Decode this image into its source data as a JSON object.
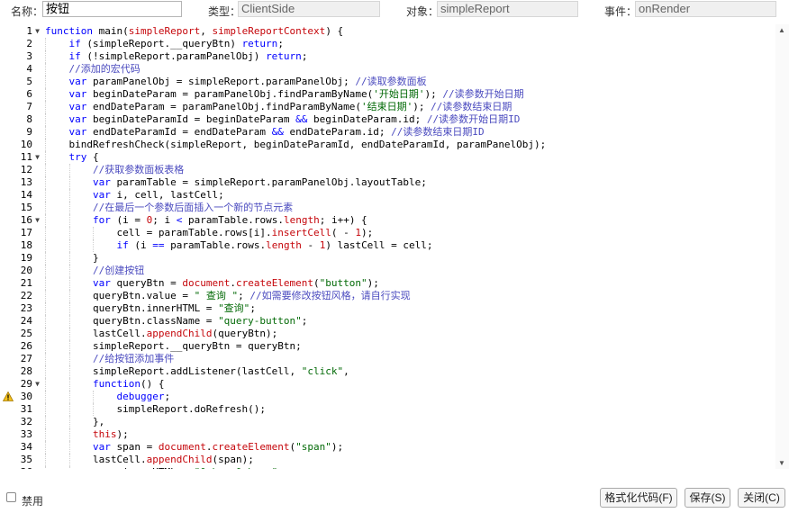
{
  "header": {
    "name_label": "名称：",
    "name_value": "按钮",
    "type_label": "类型：",
    "type_value": "ClientSide",
    "object_label": "对象：",
    "object_value": "simpleReport",
    "event_label": "事件：",
    "event_value": "onRender"
  },
  "editor": {
    "fold_lines": [
      1,
      11,
      16,
      29
    ],
    "warning_line": 30,
    "lines": [
      [
        [
          "kw",
          "function"
        ],
        [
          "id",
          " main("
        ],
        [
          "red",
          "simpleReport"
        ],
        [
          "id",
          ", "
        ],
        [
          "red",
          "simpleReportContext"
        ],
        [
          "id",
          ") {"
        ]
      ],
      [
        [
          "id",
          "    "
        ],
        [
          "kw",
          "if"
        ],
        [
          "id",
          " (simpleReport.__queryBtn) "
        ],
        [
          "kw",
          "return"
        ],
        [
          "id",
          ";"
        ]
      ],
      [
        [
          "id",
          "    "
        ],
        [
          "kw",
          "if"
        ],
        [
          "id",
          " (!simpleReport.paramPanelObj) "
        ],
        [
          "kw",
          "return"
        ],
        [
          "id",
          ";"
        ]
      ],
      [
        [
          "id",
          "    "
        ],
        [
          "cm",
          "//添加的宏代码"
        ]
      ],
      [
        [
          "id",
          "    "
        ],
        [
          "kw",
          "var"
        ],
        [
          "id",
          " paramPanelObj = simpleReport.paramPanelObj; "
        ],
        [
          "cm",
          "//读取参数面板"
        ]
      ],
      [
        [
          "id",
          "    "
        ],
        [
          "kw",
          "var"
        ],
        [
          "id",
          " beginDateParam = paramPanelObj.findParamByName("
        ],
        [
          "str",
          "'开始日期'"
        ],
        [
          "id",
          "); "
        ],
        [
          "cm",
          "//读参数开始日期"
        ]
      ],
      [
        [
          "id",
          "    "
        ],
        [
          "kw",
          "var"
        ],
        [
          "id",
          " endDateParam = paramPanelObj.findParamByName("
        ],
        [
          "str",
          "'结束日期'"
        ],
        [
          "id",
          "); "
        ],
        [
          "cm",
          "//读参数结束日期"
        ]
      ],
      [
        [
          "id",
          "    "
        ],
        [
          "kw",
          "var"
        ],
        [
          "id",
          " beginDateParamId = beginDateParam "
        ],
        [
          "op",
          "&&"
        ],
        [
          "id",
          " beginDateParam.id; "
        ],
        [
          "cm",
          "//读参数开始日期ID"
        ]
      ],
      [
        [
          "id",
          "    "
        ],
        [
          "kw",
          "var"
        ],
        [
          "id",
          " endDateParamId = endDateParam "
        ],
        [
          "op",
          "&&"
        ],
        [
          "id",
          " endDateParam.id; "
        ],
        [
          "cm",
          "//读参数结束日期ID"
        ]
      ],
      [
        [
          "id",
          "    bindRefreshCheck(simpleReport, beginDateParamId, endDateParamId, paramPanelObj);"
        ]
      ],
      [
        [
          "id",
          "    "
        ],
        [
          "kw",
          "try"
        ],
        [
          "id",
          " {"
        ]
      ],
      [
        [
          "id",
          "        "
        ],
        [
          "cm",
          "//获取参数面板表格"
        ]
      ],
      [
        [
          "id",
          "        "
        ],
        [
          "kw",
          "var"
        ],
        [
          "id",
          " paramTable = simpleReport.paramPanelObj.layoutTable;"
        ]
      ],
      [
        [
          "id",
          "        "
        ],
        [
          "kw",
          "var"
        ],
        [
          "id",
          " i, cell, lastCell;"
        ]
      ],
      [
        [
          "id",
          "        "
        ],
        [
          "cm",
          "//在最后一个参数后面插入一个新的节点元素"
        ]
      ],
      [
        [
          "id",
          "        "
        ],
        [
          "kw",
          "for"
        ],
        [
          "id",
          " (i = "
        ],
        [
          "red",
          "0"
        ],
        [
          "id",
          "; i "
        ],
        [
          "op",
          "<"
        ],
        [
          "id",
          " paramTable.rows."
        ],
        [
          "red",
          "length"
        ],
        [
          "id",
          "; i++) {"
        ]
      ],
      [
        [
          "id",
          "            cell = paramTable.rows[i]."
        ],
        [
          "red",
          "insertCell"
        ],
        [
          "id",
          "( - "
        ],
        [
          "red",
          "1"
        ],
        [
          "id",
          ");"
        ]
      ],
      [
        [
          "id",
          "            "
        ],
        [
          "kw",
          "if"
        ],
        [
          "id",
          " (i "
        ],
        [
          "op",
          "=="
        ],
        [
          "id",
          " paramTable.rows."
        ],
        [
          "red",
          "length"
        ],
        [
          "id",
          " - "
        ],
        [
          "red",
          "1"
        ],
        [
          "id",
          ") lastCell = cell;"
        ]
      ],
      [
        [
          "id",
          "        }"
        ]
      ],
      [
        [
          "id",
          "        "
        ],
        [
          "cm",
          "//创建按钮"
        ]
      ],
      [
        [
          "id",
          "        "
        ],
        [
          "kw",
          "var"
        ],
        [
          "id",
          " queryBtn = "
        ],
        [
          "red",
          "document"
        ],
        [
          "id",
          "."
        ],
        [
          "red",
          "createElement"
        ],
        [
          "id",
          "("
        ],
        [
          "str",
          "\"button\""
        ],
        [
          "id",
          ");"
        ]
      ],
      [
        [
          "id",
          "        queryBtn.value = "
        ],
        [
          "str",
          "\" 查询 \""
        ],
        [
          "id",
          "; "
        ],
        [
          "cm",
          "//如需要修改按钮风格，请自行实现"
        ]
      ],
      [
        [
          "id",
          "        queryBtn.innerHTML = "
        ],
        [
          "str",
          "\"查询\""
        ],
        [
          "id",
          ";"
        ]
      ],
      [
        [
          "id",
          "        queryBtn.className = "
        ],
        [
          "str",
          "\"query-button\""
        ],
        [
          "id",
          ";"
        ]
      ],
      [
        [
          "id",
          "        lastCell."
        ],
        [
          "red",
          "appendChild"
        ],
        [
          "id",
          "(queryBtn);"
        ]
      ],
      [
        [
          "id",
          "        simpleReport.__queryBtn = queryBtn;"
        ]
      ],
      [
        [
          "id",
          "        "
        ],
        [
          "cm",
          "//给按钮添加事件"
        ]
      ],
      [
        [
          "id",
          "        simpleReport.addListener(lastCell, "
        ],
        [
          "str",
          "\"click\""
        ],
        [
          "id",
          ","
        ]
      ],
      [
        [
          "id",
          "        "
        ],
        [
          "kw",
          "function"
        ],
        [
          "id",
          "() {"
        ]
      ],
      [
        [
          "id",
          "            "
        ],
        [
          "kw",
          "debugger"
        ],
        [
          "id",
          ";"
        ]
      ],
      [
        [
          "id",
          "            simpleReport.doRefresh();"
        ]
      ],
      [
        [
          "id",
          "        },"
        ]
      ],
      [
        [
          "id",
          "        "
        ],
        [
          "red",
          "this"
        ],
        [
          "id",
          ");"
        ]
      ],
      [
        [
          "id",
          "        "
        ],
        [
          "kw",
          "var"
        ],
        [
          "id",
          " span = "
        ],
        [
          "red",
          "document"
        ],
        [
          "id",
          "."
        ],
        [
          "red",
          "createElement"
        ],
        [
          "id",
          "("
        ],
        [
          "str",
          "\"span\""
        ],
        [
          "id",
          ");"
        ]
      ],
      [
        [
          "id",
          "        lastCell."
        ],
        [
          "red",
          "appendChild"
        ],
        [
          "id",
          "(span);"
        ]
      ],
      [
        [
          "id",
          "        span.innerHTML = "
        ],
        [
          "str",
          "\"&nbsp;&nbsp;\""
        ],
        [
          "id",
          ";"
        ]
      ]
    ]
  },
  "footer": {
    "disable_label": "禁用",
    "format_button": "格式化代码(F)",
    "save_button": "保存(S)",
    "close_button": "关闭(C)"
  }
}
